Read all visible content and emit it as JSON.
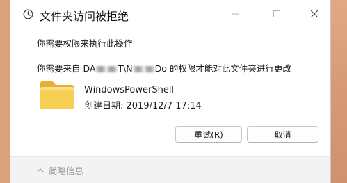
{
  "window": {
    "title": "文件夹访问被拒绝",
    "title_icon": "shield-clock-icon",
    "controls": [
      "minimize-icon",
      "maximize-icon",
      "close-icon"
    ]
  },
  "message": {
    "line1": "你需要权限来执行此操作",
    "line2_prefix": "你需要来自 DA",
    "line2_mid1": "T\\N",
    "line2_mid2": "Do 的权限才能对此文件夹进行更改"
  },
  "item": {
    "icon": "folder-icon",
    "name": "WindowsPowerShell",
    "created": "创建日期: 2019/12/7 17:14"
  },
  "buttons": {
    "retry_label": "重试(R)",
    "cancel_label": "取消"
  },
  "footer": {
    "details_label": "简略信息",
    "details_icon": "chevron-up-icon"
  },
  "colors": {
    "folder": "#f5c842",
    "wallpaper": "#d9a17c"
  }
}
